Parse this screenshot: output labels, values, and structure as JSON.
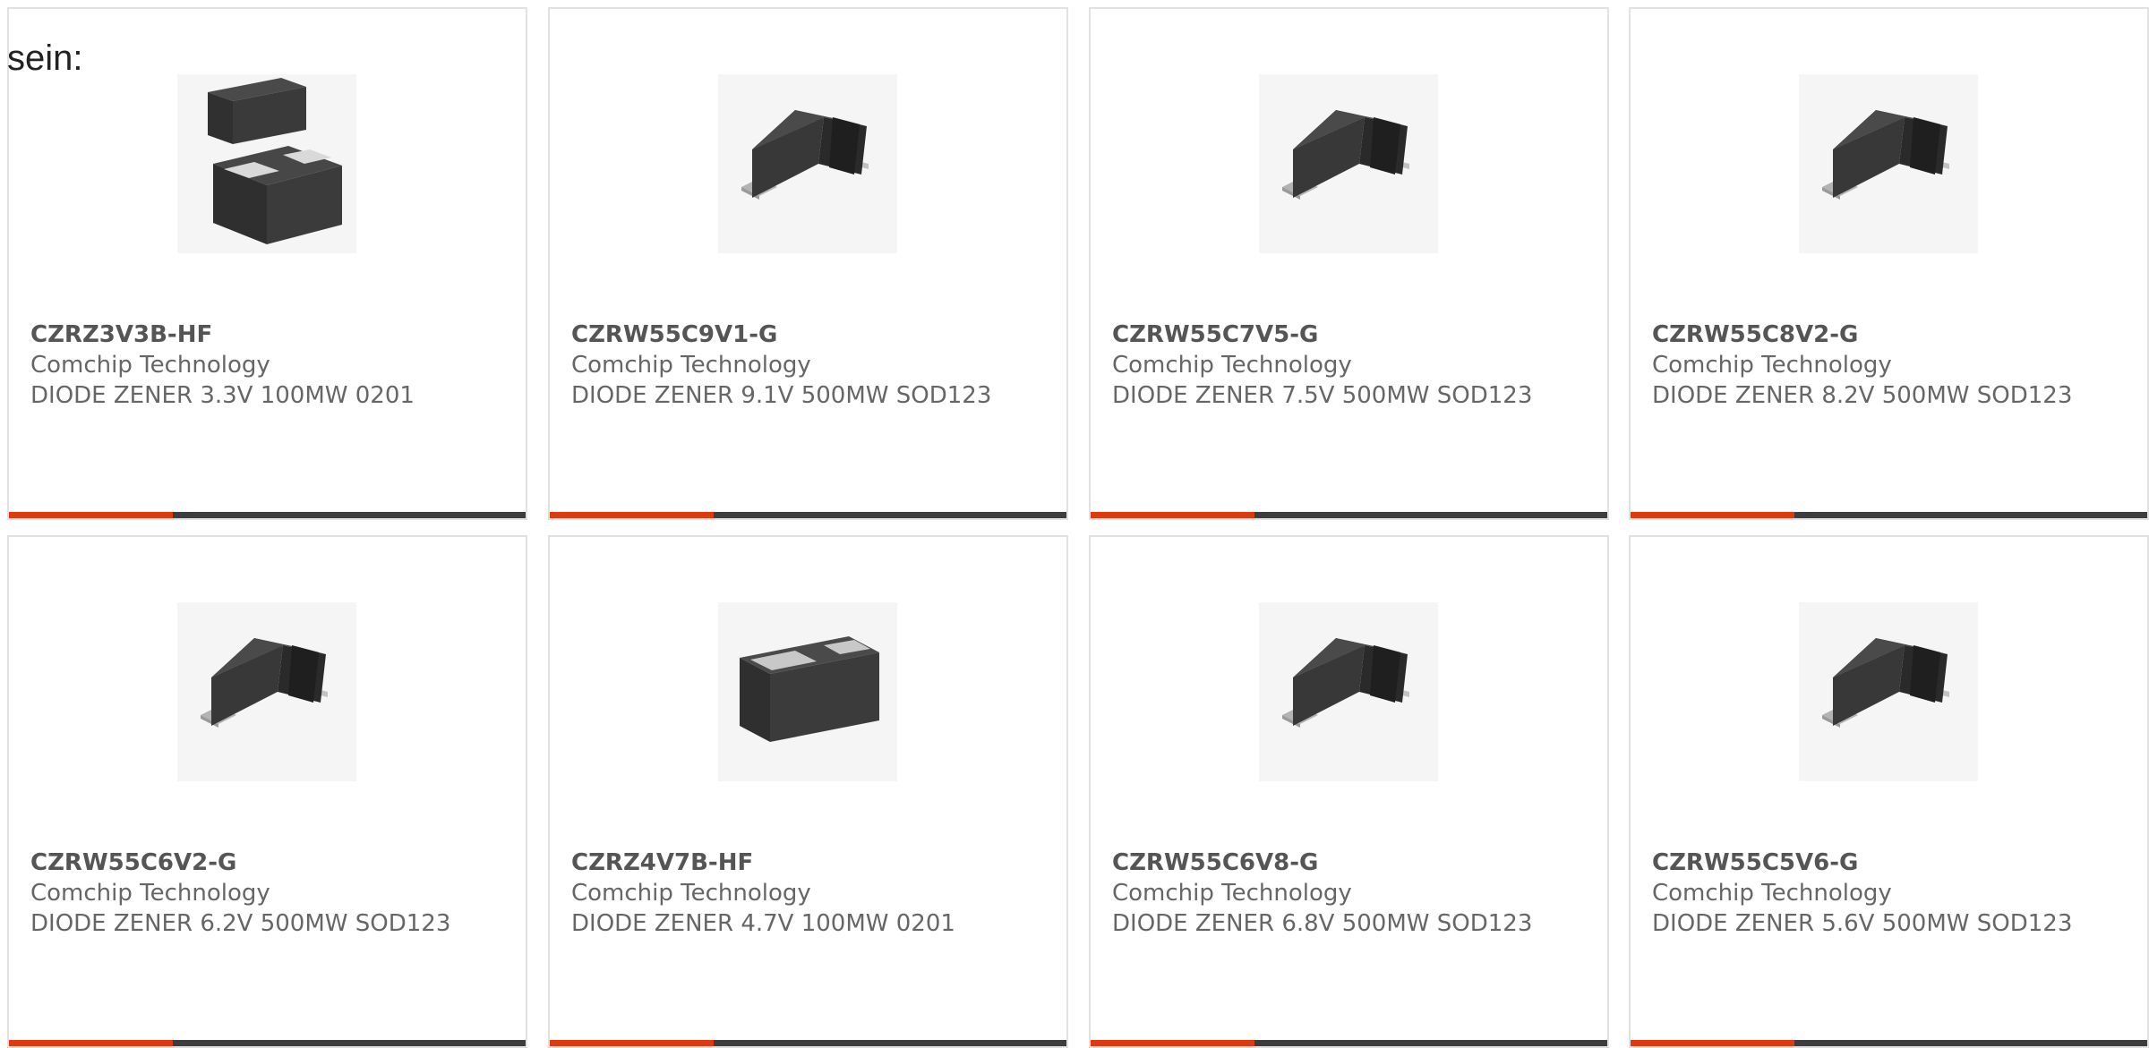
{
  "intro_text": "sein:",
  "colors": {
    "accent": "#de3a12",
    "bar": "#3d3d3d",
    "border": "#e1e1e1",
    "text": "#666666"
  },
  "products": [
    {
      "part_number": "CZRZ3V3B-HF",
      "manufacturer": "Comchip Technology",
      "description": "DIODE ZENER 3.3V 100MW 0201",
      "image_icon": "diode-0201-package-icon"
    },
    {
      "part_number": "CZRW55C9V1-G",
      "manufacturer": "Comchip Technology",
      "description": "DIODE ZENER 9.1V 500MW SOD123",
      "image_icon": "diode-sod123-package-icon"
    },
    {
      "part_number": "CZRW55C7V5-G",
      "manufacturer": "Comchip Technology",
      "description": "DIODE ZENER 7.5V 500MW SOD123",
      "image_icon": "diode-sod123-package-icon"
    },
    {
      "part_number": "CZRW55C8V2-G",
      "manufacturer": "Comchip Technology",
      "description": "DIODE ZENER 8.2V 500MW SOD123",
      "image_icon": "diode-sod123-package-icon"
    },
    {
      "part_number": "CZRW55C6V2-G",
      "manufacturer": "Comchip Technology",
      "description": "DIODE ZENER 6.2V 500MW SOD123",
      "image_icon": "diode-sod123-package-icon"
    },
    {
      "part_number": "CZRZ4V7B-HF",
      "manufacturer": "Comchip Technology",
      "description": "DIODE ZENER 4.7V 100MW 0201",
      "image_icon": "diode-0201-package-icon"
    },
    {
      "part_number": "CZRW55C6V8-G",
      "manufacturer": "Comchip Technology",
      "description": "DIODE ZENER 6.8V 500MW SOD123",
      "image_icon": "diode-sod123-package-icon"
    },
    {
      "part_number": "CZRW55C5V6-G",
      "manufacturer": "Comchip Technology",
      "description": "DIODE ZENER 5.6V 500MW SOD123",
      "image_icon": "diode-sod123-package-icon"
    }
  ]
}
